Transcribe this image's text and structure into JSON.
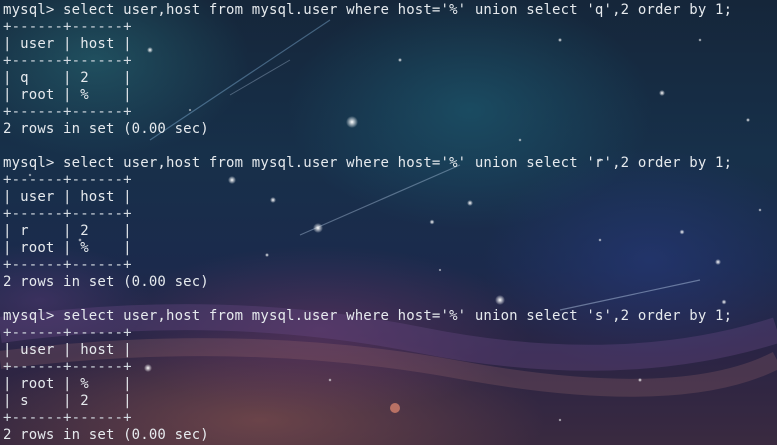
{
  "terminal": {
    "blocks": [
      {
        "command": "mysql> select user,host from mysql.user where host='%' union select 'q',2 order by 1;",
        "border_top": "+------+------+",
        "header": "| user | host |",
        "border_mid": "+------+------+",
        "rows": [
          "| q    | 2    |",
          "| root | %    |"
        ],
        "border_bottom": "+------+------+",
        "result": "2 rows in set (0.00 sec)"
      },
      {
        "command": "mysql> select user,host from mysql.user where host='%' union select 'r',2 order by 1;",
        "border_top": "+------+------+",
        "header": "| user | host |",
        "border_mid": "+------+------+",
        "rows": [
          "| r    | 2    |",
          "| root | %    |"
        ],
        "border_bottom": "+------+------+",
        "result": "2 rows in set (0.00 sec)"
      },
      {
        "command": "mysql> select user,host from mysql.user where host='%' union select 's',2 order by 1;",
        "border_top": "+------+------+",
        "header": "| user | host |",
        "border_mid": "+------+------+",
        "rows": [
          "| root | %    |",
          "| s    | 2    |"
        ],
        "border_bottom": "+------+------+",
        "result": "2 rows in set (0.00 sec)"
      }
    ]
  }
}
